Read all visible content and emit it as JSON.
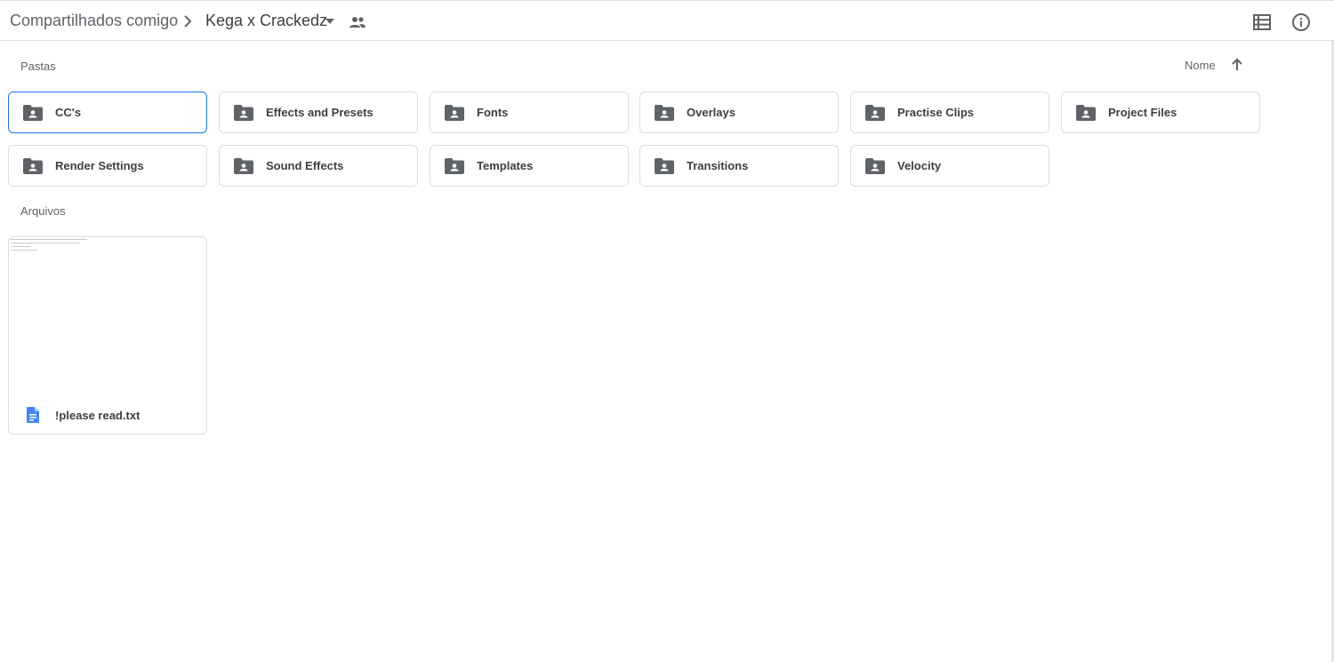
{
  "breadcrumb": {
    "root": "Compartilhados comigo",
    "current": "Kega x Crackedz"
  },
  "icons": {
    "separator": "chevron-right-icon",
    "caret": "arrow-drop-down-icon",
    "shared": "people-icon",
    "list_view": "list-view-icon",
    "info": "info-icon",
    "sort": "arrow-up-icon",
    "folder": "shared-folder-icon",
    "document": "google-doc-icon"
  },
  "sections": {
    "folders_label": "Pastas",
    "files_label": "Arquivos",
    "sort_label": "Nome"
  },
  "folders": [
    {
      "name": "CC's",
      "selected": true
    },
    {
      "name": "Effects and Presets",
      "selected": false
    },
    {
      "name": "Fonts",
      "selected": false
    },
    {
      "name": "Overlays",
      "selected": false
    },
    {
      "name": "Practise Clips",
      "selected": false
    },
    {
      "name": "Project Files",
      "selected": false
    },
    {
      "name": "Render Settings",
      "selected": false
    },
    {
      "name": "Sound Effects",
      "selected": false
    },
    {
      "name": "Templates",
      "selected": false
    },
    {
      "name": "Transitions",
      "selected": false
    },
    {
      "name": "Velocity",
      "selected": false
    }
  ],
  "files": [
    {
      "name": "!please read.txt"
    }
  ],
  "colors": {
    "accent": "#1a73e8",
    "icon": "#5f6368",
    "border": "#dadce0",
    "doc_icon": "#4285f4"
  }
}
